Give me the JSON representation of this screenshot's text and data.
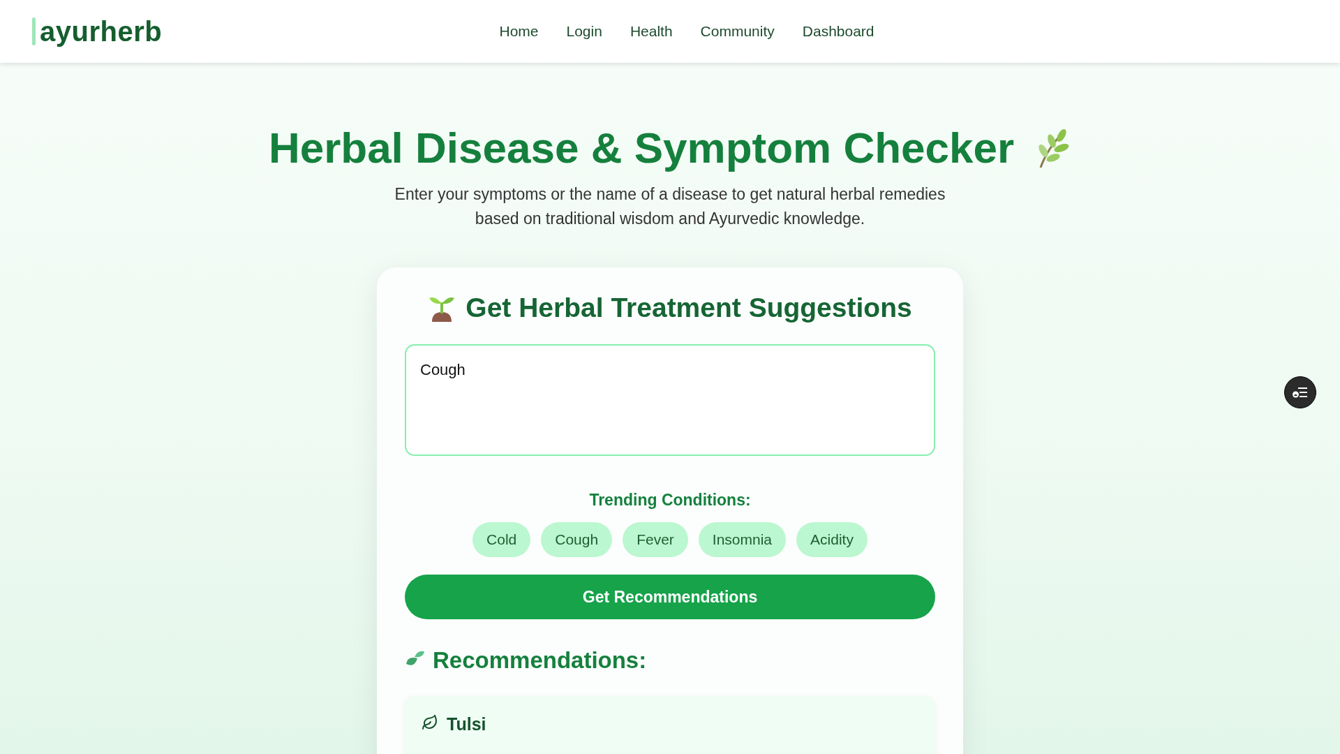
{
  "logo": "ayurherb",
  "nav": [
    {
      "label": "Home"
    },
    {
      "label": "Login"
    },
    {
      "label": "Health"
    },
    {
      "label": "Community"
    },
    {
      "label": "Dashboard"
    }
  ],
  "hero": {
    "title": "Herbal Disease & Symptom Checker",
    "subtitle": "Enter your symptoms or the name of a disease to get natural herbal remedies based on traditional wisdom and Ayurvedic knowledge."
  },
  "form": {
    "title": "Get Herbal Treatment Suggestions",
    "query": "Cough",
    "trending_label": "Trending Conditions:",
    "trending": [
      {
        "label": "Cold"
      },
      {
        "label": "Cough"
      },
      {
        "label": "Fever"
      },
      {
        "label": "Insomnia"
      },
      {
        "label": "Acidity"
      }
    ],
    "submit": "Get Recommendations"
  },
  "recommendations": {
    "title": "Recommendations:",
    "items": [
      {
        "name": "Tulsi"
      }
    ]
  }
}
